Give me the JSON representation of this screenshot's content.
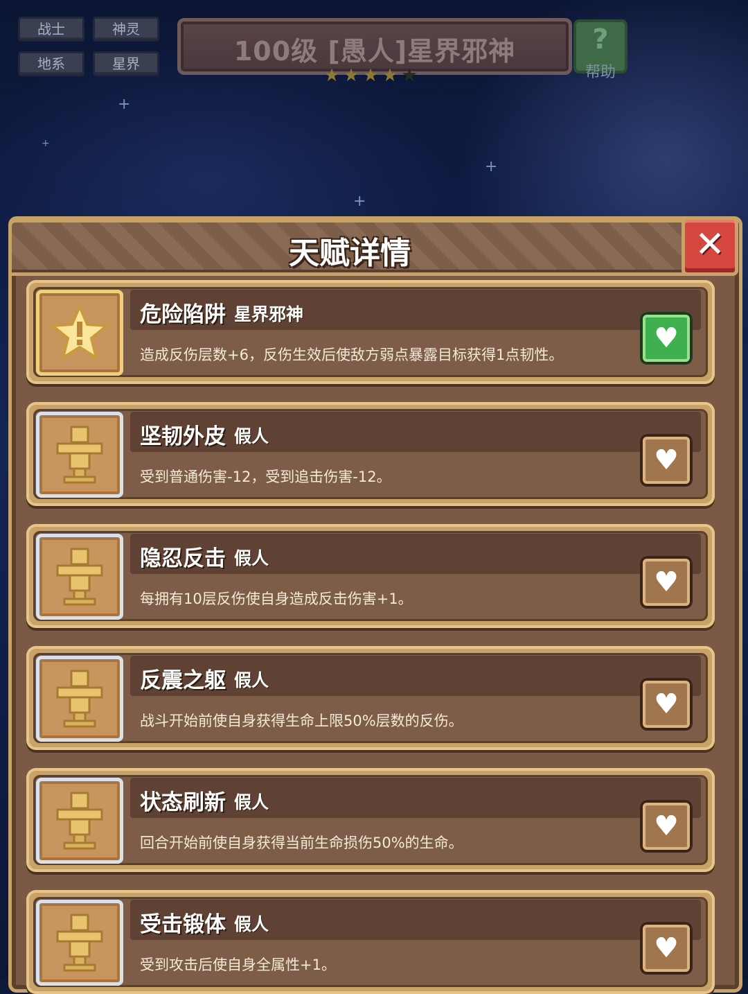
{
  "header": {
    "tags": [
      "战士",
      "神灵",
      "地系",
      "星界"
    ],
    "title": "100级 [愚人]星界邪神",
    "star_rating": 4,
    "star_max": 5,
    "help_label": "帮助",
    "help_symbol": "?"
  },
  "panel": {
    "title": "天赋详情",
    "close_symbol": "✕"
  },
  "talents": [
    {
      "name": "危险陷阱",
      "owner": "星界邪神",
      "description": "造成反伤层数+6，反伤生效后使敌方弱点暴露目标获得1点韧性。",
      "favorited": true,
      "icon": "star-icon"
    },
    {
      "name": "坚韧外皮",
      "owner": "假人",
      "description": "受到普通伤害-12，受到追击伤害-12。",
      "favorited": false,
      "icon": "dummy-icon"
    },
    {
      "name": "隐忍反击",
      "owner": "假人",
      "description": "每拥有10层反伤使自身造成反击伤害+1。",
      "favorited": false,
      "icon": "dummy-icon"
    },
    {
      "name": "反震之躯",
      "owner": "假人",
      "description": "战斗开始前使自身获得生命上限50%层数的反伤。",
      "favorited": false,
      "icon": "dummy-icon"
    },
    {
      "name": "状态刷新",
      "owner": "假人",
      "description": "回合开始前使自身获得当前生命损伤50%的生命。",
      "favorited": false,
      "icon": "dummy-icon"
    },
    {
      "name": "受击锻体",
      "owner": "假人",
      "description": "受到攻击后使自身全属性+1。",
      "favorited": false,
      "icon": "dummy-icon"
    }
  ],
  "colors": {
    "panel": "#7a5a44",
    "border_gold": "#c9a268",
    "favorite_active": "#3fb04e",
    "close_red": "#d5473f"
  }
}
